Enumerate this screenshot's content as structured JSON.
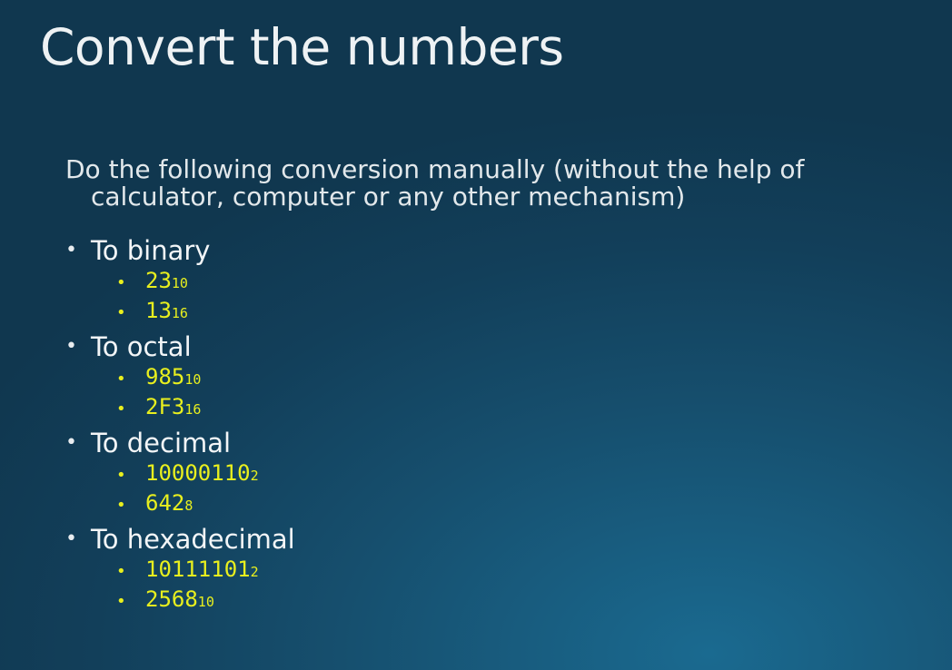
{
  "slide": {
    "title": "Convert the numbers",
    "intro": {
      "line1": "Do the following conversion manually (without the help of",
      "line2": "calculator, computer or any other mechanism)"
    },
    "bullet_glyph": "•",
    "colors": {
      "title": "#eef2f4",
      "body_text": "#e2e8eb",
      "highlight": "#e8ef1e",
      "background_dark": "#10374f",
      "background_light": "#1a6a90"
    },
    "topics": [
      {
        "label": "To binary",
        "items": [
          {
            "value": "23",
            "base": "10"
          },
          {
            "value": "13",
            "base": "16"
          }
        ]
      },
      {
        "label": "To octal",
        "items": [
          {
            "value": "985",
            "base": "10"
          },
          {
            "value": "2F3",
            "base": "16"
          }
        ]
      },
      {
        "label": "To decimal",
        "items": [
          {
            "value": "10000110",
            "base": "2"
          },
          {
            "value": "642",
            "base": "8"
          }
        ]
      },
      {
        "label": "To hexadecimal",
        "items": [
          {
            "value": "10111101",
            "base": "2"
          },
          {
            "value": "2568",
            "base": "10"
          }
        ]
      }
    ]
  }
}
